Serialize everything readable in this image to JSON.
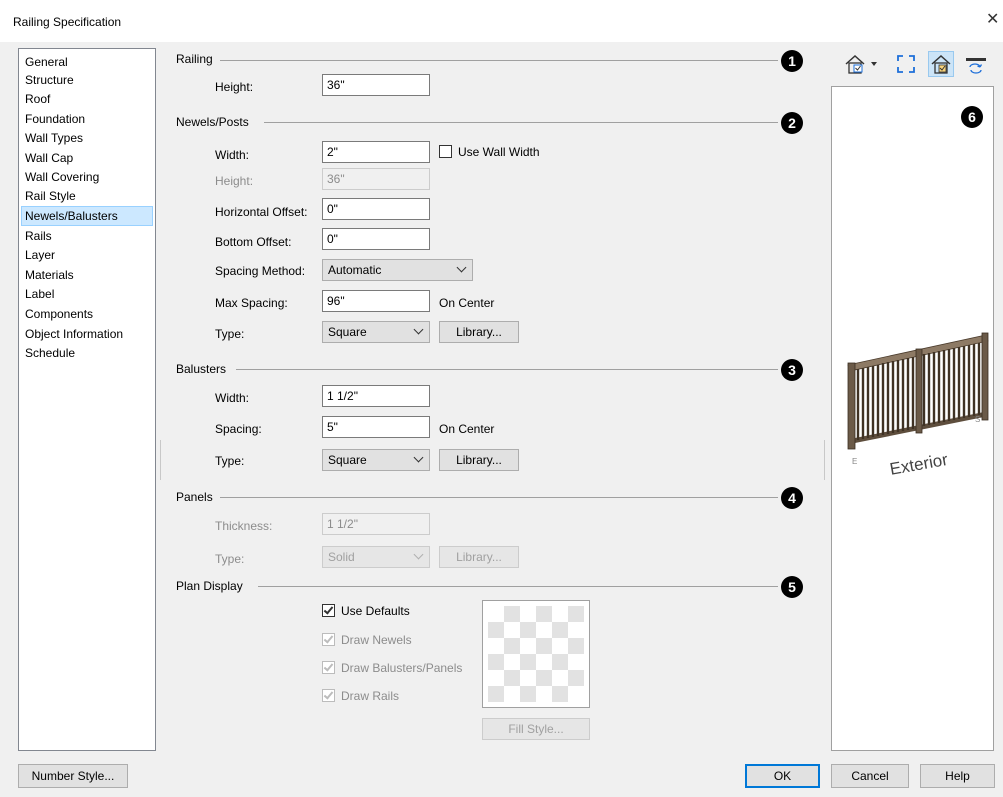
{
  "window": {
    "title": "Railing Specification",
    "close_glyph": "✕"
  },
  "sidebar": {
    "items": [
      {
        "label": "General"
      },
      {
        "label": "Structure"
      },
      {
        "label": "Roof"
      },
      {
        "label": "Foundation"
      },
      {
        "label": "Wall Types"
      },
      {
        "label": "Wall Cap"
      },
      {
        "label": "Wall Covering"
      },
      {
        "label": "Rail Style"
      },
      {
        "label": "Newels/Balusters",
        "selected": true
      },
      {
        "label": "Rails"
      },
      {
        "label": "Layer"
      },
      {
        "label": "Materials"
      },
      {
        "label": "Label"
      },
      {
        "label": "Components"
      },
      {
        "label": "Object Information"
      },
      {
        "label": "Schedule"
      }
    ]
  },
  "railing": {
    "title": "Railing",
    "badge": "1",
    "height_label": "Height:",
    "height_value": "36\""
  },
  "newels": {
    "title": "Newels/Posts",
    "badge": "2",
    "width_label": "Width:",
    "width_value": "2\"",
    "use_wall_width_label": "Use Wall Width",
    "use_wall_width_checked": false,
    "height_label": "Height:",
    "height_value": "36\"",
    "h_offset_label": "Horizontal Offset:",
    "h_offset_value": "0\"",
    "b_offset_label": "Bottom Offset:",
    "b_offset_value": "0\"",
    "spacing_method_label": "Spacing Method:",
    "spacing_method_value": "Automatic",
    "max_spacing_label": "Max Spacing:",
    "max_spacing_value": "96\"",
    "max_spacing_suffix": "On Center",
    "type_label": "Type:",
    "type_value": "Square",
    "library_label": "Library..."
  },
  "balusters": {
    "title": "Balusters",
    "badge": "3",
    "width_label": "Width:",
    "width_value": "1 1/2\"",
    "spacing_label": "Spacing:",
    "spacing_value": "5\"",
    "spacing_suffix": "On Center",
    "type_label": "Type:",
    "type_value": "Square",
    "library_label": "Library..."
  },
  "panels": {
    "title": "Panels",
    "badge": "4",
    "thickness_label": "Thickness:",
    "thickness_value": "1 1/2\"",
    "type_label": "Type:",
    "type_value": "Solid",
    "library_label": "Library..."
  },
  "plan_display": {
    "title": "Plan Display",
    "badge": "5",
    "use_defaults_label": "Use Defaults",
    "use_defaults_checked": true,
    "draw_newels_label": "Draw Newels",
    "draw_balusters_label": "Draw Balusters/Panels",
    "draw_rails_label": "Draw Rails",
    "fill_style_label": "Fill Style..."
  },
  "preview": {
    "badge": "6",
    "exterior_label": "Exterior",
    "mark_e": "E",
    "mark_s": "S",
    "toolbar_icons": [
      "house-view-dropdown-icon",
      "fit-window-icon",
      "show-all-icon",
      "toggle-view-icon"
    ]
  },
  "footer": {
    "number_style_label": "Number Style...",
    "ok_label": "OK",
    "cancel_label": "Cancel",
    "help_label": "Help"
  },
  "colors": {
    "selection_bg": "#cce8ff",
    "default_button_border": "#0078d7",
    "disabled_text": "#8c8c8c",
    "railing_wood": "#6b5a48"
  }
}
